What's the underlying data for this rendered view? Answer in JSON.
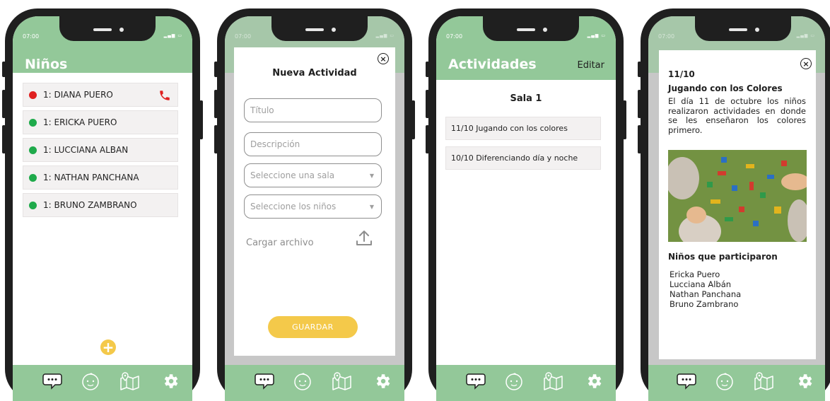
{
  "status_time": "07:00",
  "tabbar_icons": [
    "chat-icon",
    "baby-face-icon",
    "map-icon",
    "gear-icon"
  ],
  "colors": {
    "primary_green": "#93c899",
    "accent_yellow": "#f4c94a",
    "status_red": "#e02020",
    "status_green": "#1faa4b",
    "phone_frame": "#1f1f1f"
  },
  "screen1": {
    "title": "Niños",
    "children": [
      {
        "name": "1: DIANA PUERO",
        "status": "red",
        "has_call": true
      },
      {
        "name": "1: ERICKA PUERO",
        "status": "green",
        "has_call": false
      },
      {
        "name": "1: LUCCIANA ALBAN",
        "status": "green",
        "has_call": false
      },
      {
        "name": "1: NATHAN PANCHANA",
        "status": "green",
        "has_call": false
      },
      {
        "name": "1: BRUNO ZAMBRANO",
        "status": "green",
        "has_call": false
      }
    ],
    "add_label": "+"
  },
  "screen2": {
    "title": "Nueva Actividad",
    "close_label": "×",
    "title_placeholder": "Título",
    "description_placeholder": "Descripción",
    "room_select": "Seleccione una sala",
    "kids_select": "Seleccione los niños",
    "upload_label": "Cargar archivo",
    "save_label": "GUARDAR"
  },
  "screen3": {
    "title": "Actividades",
    "edit_label": "Editar",
    "room": "Sala 1",
    "activities": [
      "11/10 Jugando con los colores",
      "10/10 Diferenciando día y noche"
    ]
  },
  "screen4": {
    "close_label": "×",
    "date": "11/10",
    "title": "Jugando con los Colores",
    "description": "El día 11 de octubre los niños realizaron actividades en donde se les enseñaron los colores primero.",
    "participants_title": "Niños que participaron",
    "participants": [
      "Ericka Puero",
      "Lucciana Albán",
      "Nathan Panchana",
      "Bruno Zambrano"
    ]
  }
}
